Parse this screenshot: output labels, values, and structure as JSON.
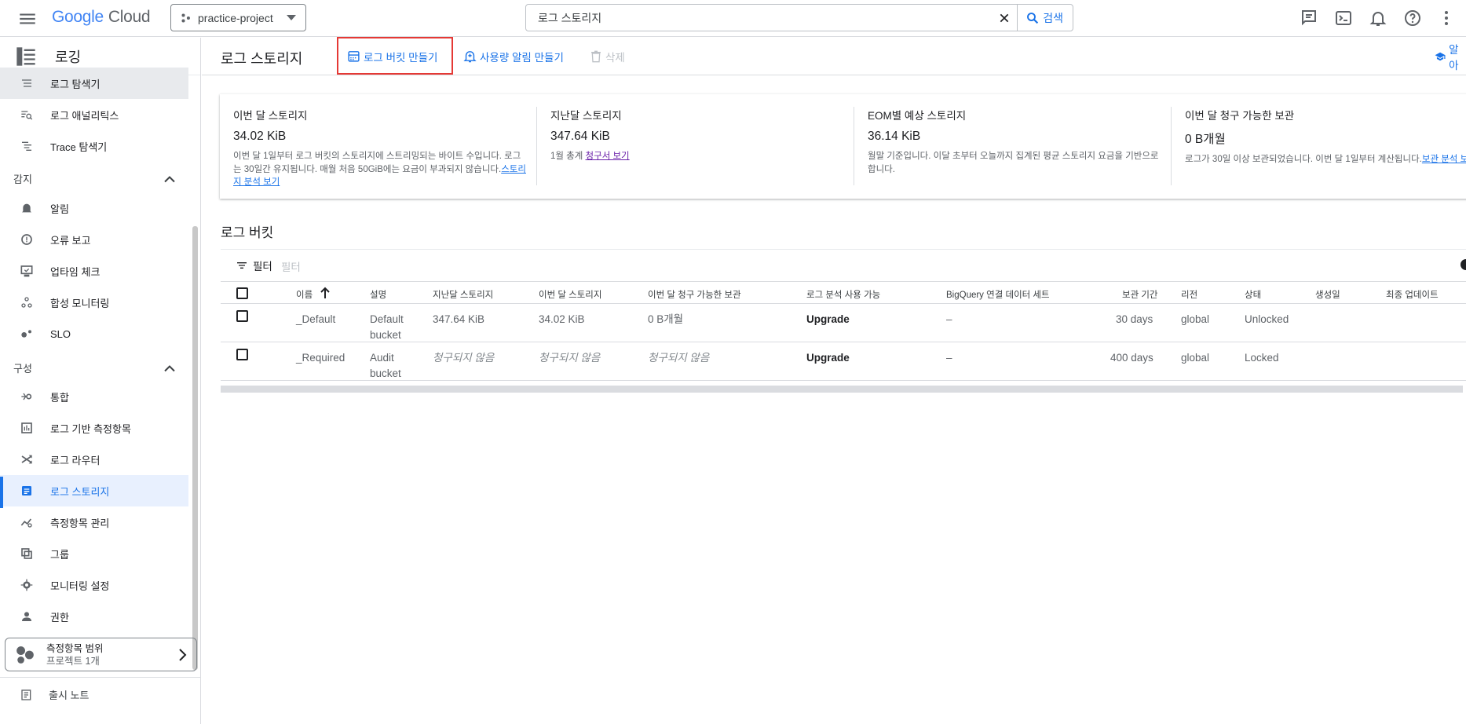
{
  "header": {
    "logo_google": "Google",
    "logo_cloud": "Cloud",
    "project": "practice-project",
    "search_value": "로그 스토리지",
    "search_button": "검색"
  },
  "sidebar": {
    "title": "로깅",
    "items_top": [
      {
        "label": "로그 탐색기"
      },
      {
        "label": "로그 애널리틱스"
      },
      {
        "label": "Trace 탐색기"
      }
    ],
    "section_monitor": "감지",
    "items_monitor": [
      {
        "label": "알림"
      },
      {
        "label": "오류 보고"
      },
      {
        "label": "업타임 체크"
      },
      {
        "label": "합성 모니터링"
      },
      {
        "label": "SLO"
      }
    ],
    "section_config": "구성",
    "items_config": [
      {
        "label": "통합"
      },
      {
        "label": "로그 기반 측정항목"
      },
      {
        "label": "로그 라우터"
      },
      {
        "label": "로그 스토리지"
      },
      {
        "label": "측정항목 관리"
      },
      {
        "label": "그룹"
      },
      {
        "label": "모니터링 설정"
      },
      {
        "label": "권한"
      }
    ],
    "scope_title": "측정항목 범위",
    "scope_sub": "프로젝트 1개",
    "release_notes": "출시 노트"
  },
  "toolbar": {
    "page_title": "로그 스토리지",
    "create_bucket": "로그 버킷 만들기",
    "create_alert": "사용량 알림 만들기",
    "delete": "삭제",
    "learn": "알아"
  },
  "summary": [
    {
      "title": "이번 달 스토리지",
      "value": "34.02 KiB",
      "desc": "이번 달 1일부터 로그 버킷의 스토리지에 스트리밍되는 바이트 수입니다. 로그는 30일간 유지됩니다. 매월 처음 50GiB에는 요금이 부과되지 않습니다.",
      "link": "스토리지 분석 보기"
    },
    {
      "title": "지난달 스토리지",
      "value": "347.64 KiB",
      "desc": "1월 총계 ",
      "link": "청구서 보기"
    },
    {
      "title": "EOM별 예상 스토리지",
      "value": "36.14 KiB",
      "desc": "월말 기준입니다. 이달 초부터 오늘까지 집계된 평균 스토리지 요금을 기반으로 합니다.",
      "link": ""
    },
    {
      "title": "이번 달 청구 가능한 보관",
      "value": "0 B개월",
      "desc": "로그가 30일 이상 보관되었습니다. 이번 달 1일부터 계산됩니다.",
      "link": "보관 분석 보기"
    }
  ],
  "buckets": {
    "title": "로그 버킷",
    "filter_label": "필터",
    "filter_placeholder": "필터",
    "columns": [
      "이름",
      "설명",
      "지난달 스토리지",
      "이번 달 스토리지",
      "이번 달 청구 가능한 보관",
      "로그 분석 사용 가능",
      "BigQuery 연결 데이터 세트",
      "보관 기간",
      "리전",
      "상태",
      "생성일",
      "최종 업데이트"
    ],
    "rows": [
      {
        "name": "_Default",
        "desc1": "Default",
        "desc2": "bucket",
        "last": "347.64 KiB",
        "this": "34.02 KiB",
        "billable": "0 B개월",
        "analytics": "Upgrade",
        "bq": "–",
        "retention": "30 days",
        "region": "global",
        "state": "Unlocked"
      },
      {
        "name": "_Required",
        "desc1": "Audit",
        "desc2": "bucket",
        "last": "청구되지 않음",
        "this": "청구되지 않음",
        "billable": "청구되지 않음",
        "analytics": "Upgrade",
        "bq": "–",
        "retention": "400 days",
        "region": "global",
        "state": "Locked"
      }
    ]
  },
  "colors": {
    "accent": "#1a73e8",
    "highlight": "#e53935",
    "active_bg": "#e8f0fe"
  }
}
